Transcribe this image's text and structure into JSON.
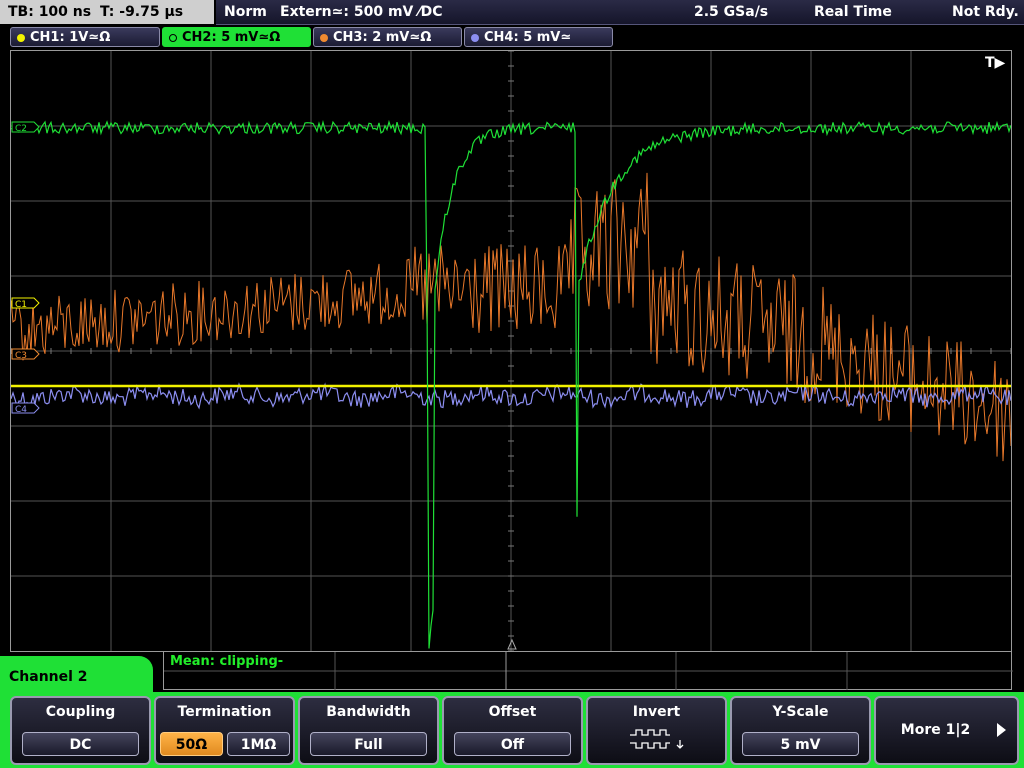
{
  "status_bar": {
    "timebase": "TB: 100 ns",
    "trigger_time": "T: -9.75 µs",
    "trigger_mode": "Norm",
    "trigger_source": "Extern≃: 500 mV ⁄DC",
    "sample_rate": "2.5 GSa/s",
    "acq_mode": "Real Time",
    "state": "Not Rdy."
  },
  "channels": [
    {
      "label": "CH1: 1V≃Ω",
      "color": "#f2f200"
    },
    {
      "label": "CH2: 5 mV≃Ω",
      "color": "#1fe036"
    },
    {
      "label": "CH3: 2 mV≃Ω",
      "color": "#f08a30"
    },
    {
      "label": "CH4: 5 mV≃",
      "color": "#8c8ef0"
    }
  ],
  "markers": {
    "trigger_pos": "T▶",
    "ch1": "C1",
    "ch2": "C2",
    "ch3": "C3",
    "ch4": "C4"
  },
  "measurement": {
    "text": "Mean: clipping-"
  },
  "panel": {
    "title": "Channel 2"
  },
  "softkeys": {
    "coupling": {
      "title": "Coupling",
      "value": "DC"
    },
    "termination": {
      "title": "Termination",
      "opt1": "50Ω",
      "opt2": "1MΩ"
    },
    "bandwidth": {
      "title": "Bandwidth",
      "value": "Full"
    },
    "offset": {
      "title": "Offset",
      "value": "Off"
    },
    "invert": {
      "title": "Invert"
    },
    "yscale": {
      "title": "Y-Scale",
      "value": "5 mV"
    },
    "more": {
      "label": "More 1|2"
    }
  }
}
